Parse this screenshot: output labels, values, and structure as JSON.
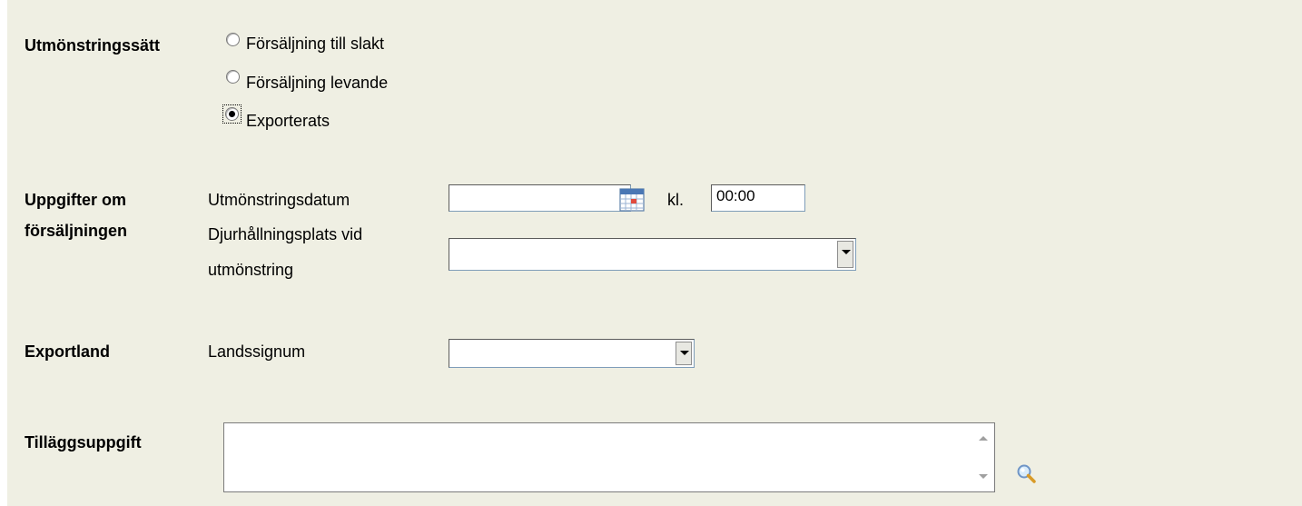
{
  "method": {
    "label": "Utmönstringssätt",
    "options": [
      "Försäljning till slakt",
      "Försäljning levande",
      "Exporterats"
    ],
    "selected": "Exporterats"
  },
  "sale": {
    "label_line1": "Uppgifter om",
    "label_line2": "försäljningen",
    "date_label": "Utmönstringsdatum",
    "date_value": "",
    "time_prefix": "kl.",
    "time_value": "00:00",
    "holding_label_line1": "Djurhållningsplats vid",
    "holding_label_line2": "utmönstring",
    "holding_value": ""
  },
  "export": {
    "label": "Exportland",
    "country_label": "Landssignum",
    "country_value": ""
  },
  "additional": {
    "label": "Tilläggsuppgift",
    "value": ""
  },
  "icons": {
    "calendar": "calendar-icon",
    "search": "search-icon"
  },
  "colors": {
    "panel_background": "#efefe3",
    "input_border": "#7f9db9"
  }
}
